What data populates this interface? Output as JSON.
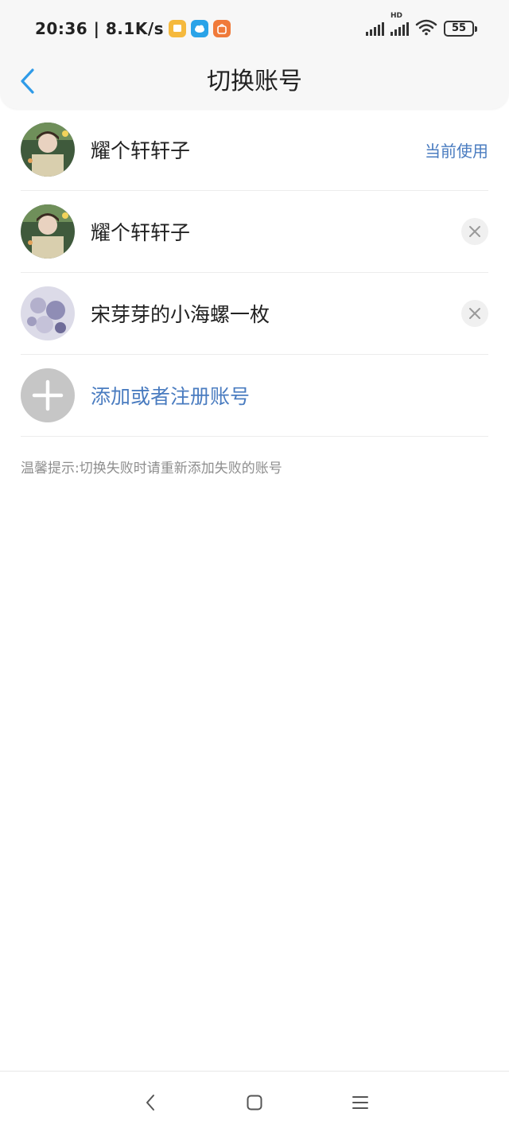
{
  "status_bar": {
    "time_and_speed": "20:36 | 8.1K/s",
    "app_icons": [
      "notes-app-icon",
      "cloud-app-icon",
      "store-app-icon"
    ],
    "battery": "55",
    "network": "HD"
  },
  "header": {
    "title": "切换账号",
    "back_icon": "chevron-left-icon"
  },
  "accounts": [
    {
      "name": "耀个轩轩子",
      "status": "当前使用",
      "action": "none"
    },
    {
      "name": "耀个轩轩子",
      "status": "",
      "action": "remove"
    },
    {
      "name": "宋芽芽的小海螺一枚",
      "status": "",
      "action": "remove"
    }
  ],
  "add_account": {
    "label": "添加或者注册账号",
    "icon": "plus-icon"
  },
  "tip": "温馨提示:切换失败时请重新添加失败的账号",
  "nav": {
    "back_icon": "nav-back-icon",
    "home_icon": "nav-home-icon",
    "menu_icon": "nav-menu-icon"
  },
  "colors": {
    "accent": "#4a7cc0",
    "back_arrow": "#2f9be8",
    "header_bg": "#f7f7f7",
    "add_circle": "#c6c6c6"
  }
}
